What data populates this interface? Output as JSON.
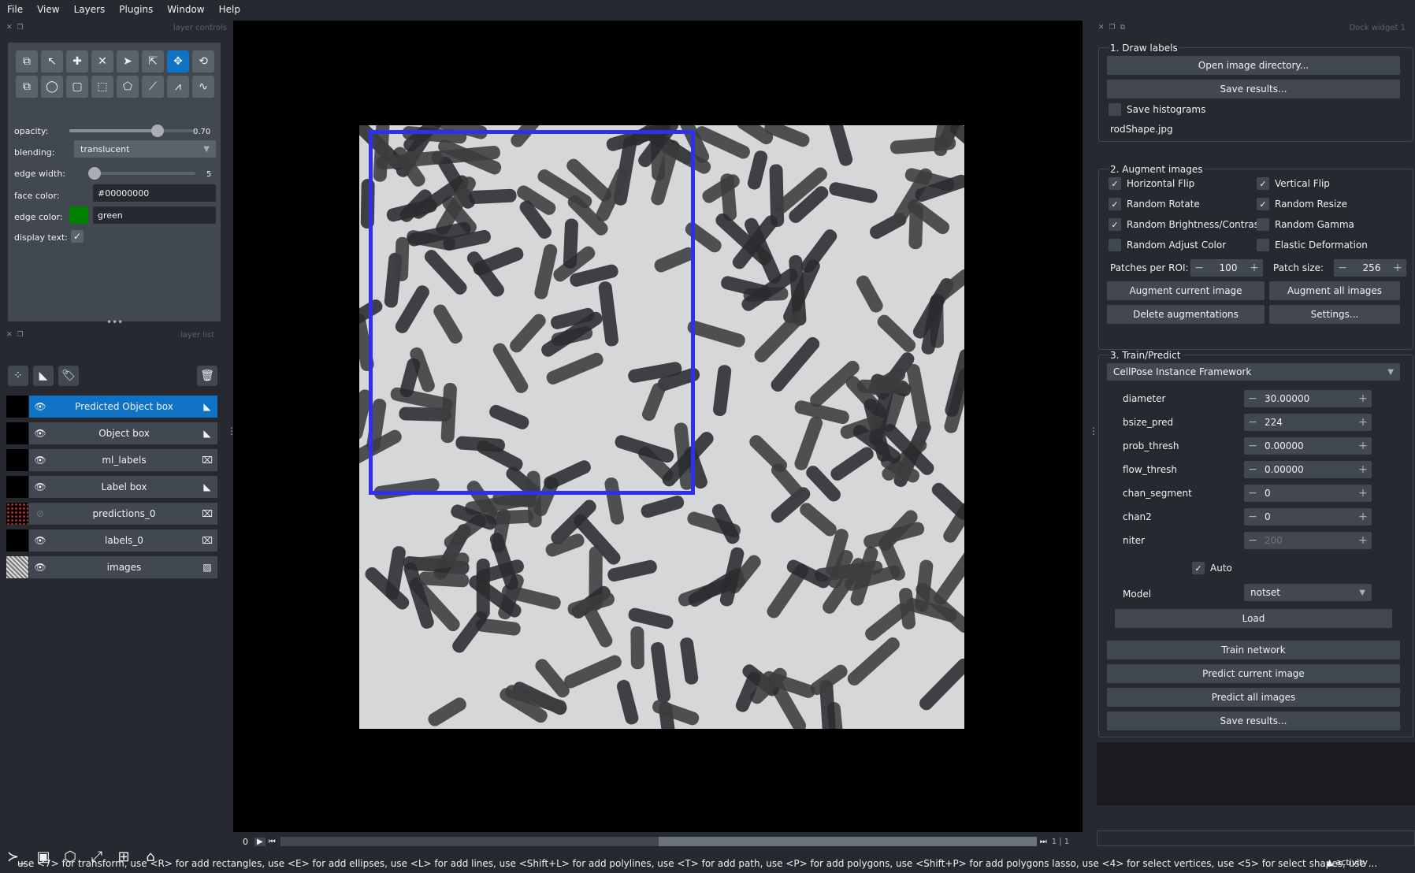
{
  "menu": [
    "File",
    "View",
    "Layers",
    "Plugins",
    "Window",
    "Help"
  ],
  "layer_controls": {
    "dock_title": "layer controls",
    "opacity_label": "opacity:",
    "opacity_value": "0.70",
    "opacity_level": 0.7,
    "blending_label": "blending:",
    "blending_value": "translucent",
    "edge_width_label": "edge width:",
    "edge_width_value": "5",
    "face_color_label": "face color:",
    "face_color_value": "#00000000",
    "edge_color_label": "edge color:",
    "edge_color_value": "green",
    "edge_color_swatch": "#008000",
    "display_text_label": "display text:",
    "display_text_checked": true
  },
  "layer_list": {
    "dock_title": "layer list",
    "layers": [
      {
        "name": "Predicted Object box",
        "type_icon": "shapes-icon",
        "selected": true,
        "visible": true
      },
      {
        "name": "Object box",
        "type_icon": "shapes-icon",
        "selected": false,
        "visible": true
      },
      {
        "name": "ml_labels",
        "type_icon": "labels-icon",
        "selected": false,
        "visible": true
      },
      {
        "name": "Label box",
        "type_icon": "shapes-icon",
        "selected": false,
        "visible": true
      },
      {
        "name": "predictions_0",
        "type_icon": "labels-icon",
        "selected": false,
        "visible": false
      },
      {
        "name": "labels_0",
        "type_icon": "labels-icon",
        "selected": false,
        "visible": true
      },
      {
        "name": "images",
        "type_icon": "image-icon",
        "selected": false,
        "visible": true
      }
    ]
  },
  "dims": {
    "frame": "0",
    "slice_readout": "1 | 1"
  },
  "status": {
    "text": "use <7> for transform, use <R> for add rectangles, use <E> for add ellipses, use <L> for add lines, use <Shift+L> for add polylines, use <T> for add path, use <P> for add polygons, use <Shift+P> for add polygons lasso, use <4> for select vertices, use <5> for select shapes, use ...",
    "activity": "activity"
  },
  "dock": {
    "title": "Dock widget 1",
    "draw": {
      "title": "1. Draw labels",
      "open_btn": "Open image directory...",
      "save_btn": "Save results...",
      "save_hist": "Save histograms",
      "filename": "rodShape.jpg"
    },
    "augment": {
      "title": "2. Augment images",
      "checks": [
        {
          "label": "Horizontal Flip",
          "checked": true
        },
        {
          "label": "Vertical Flip",
          "checked": true
        },
        {
          "label": "Random Rotate",
          "checked": true
        },
        {
          "label": "Random Resize",
          "checked": true
        },
        {
          "label": "Random Brightness/Contrast",
          "checked": true
        },
        {
          "label": "Random Gamma",
          "checked": false
        },
        {
          "label": "Random Adjust Color",
          "checked": false
        },
        {
          "label": "Elastic Deformation",
          "checked": false
        }
      ],
      "patches_label": "Patches per ROI:",
      "patches_value": "100",
      "patch_size_label": "Patch size:",
      "patch_size_value": "256",
      "aug_current": "Augment current image",
      "aug_all": "Augment all images",
      "delete": "Delete augmentations",
      "settings": "Settings..."
    },
    "train": {
      "title": "3. Train/Predict",
      "framework": "CellPose Instance Framework",
      "params": [
        {
          "label": "diameter",
          "value": "30.00000"
        },
        {
          "label": "bsize_pred",
          "value": "224"
        },
        {
          "label": "prob_thresh",
          "value": "0.00000"
        },
        {
          "label": "flow_thresh",
          "value": "0.00000"
        },
        {
          "label": "chan_segment",
          "value": "0"
        },
        {
          "label": "chan2",
          "value": "0"
        },
        {
          "label": "niter",
          "value": "200"
        }
      ],
      "auto_label": "Auto",
      "model_label": "Model",
      "model_value": "notset",
      "load": "Load",
      "train": "Train network",
      "predict_current": "Predict current image",
      "predict_all": "Predict all images",
      "save": "Save results..."
    }
  },
  "colors": {
    "accent": "#0f72c4",
    "bbox": "#2f2ff0",
    "bg": "#262930",
    "panel": "#414851"
  }
}
